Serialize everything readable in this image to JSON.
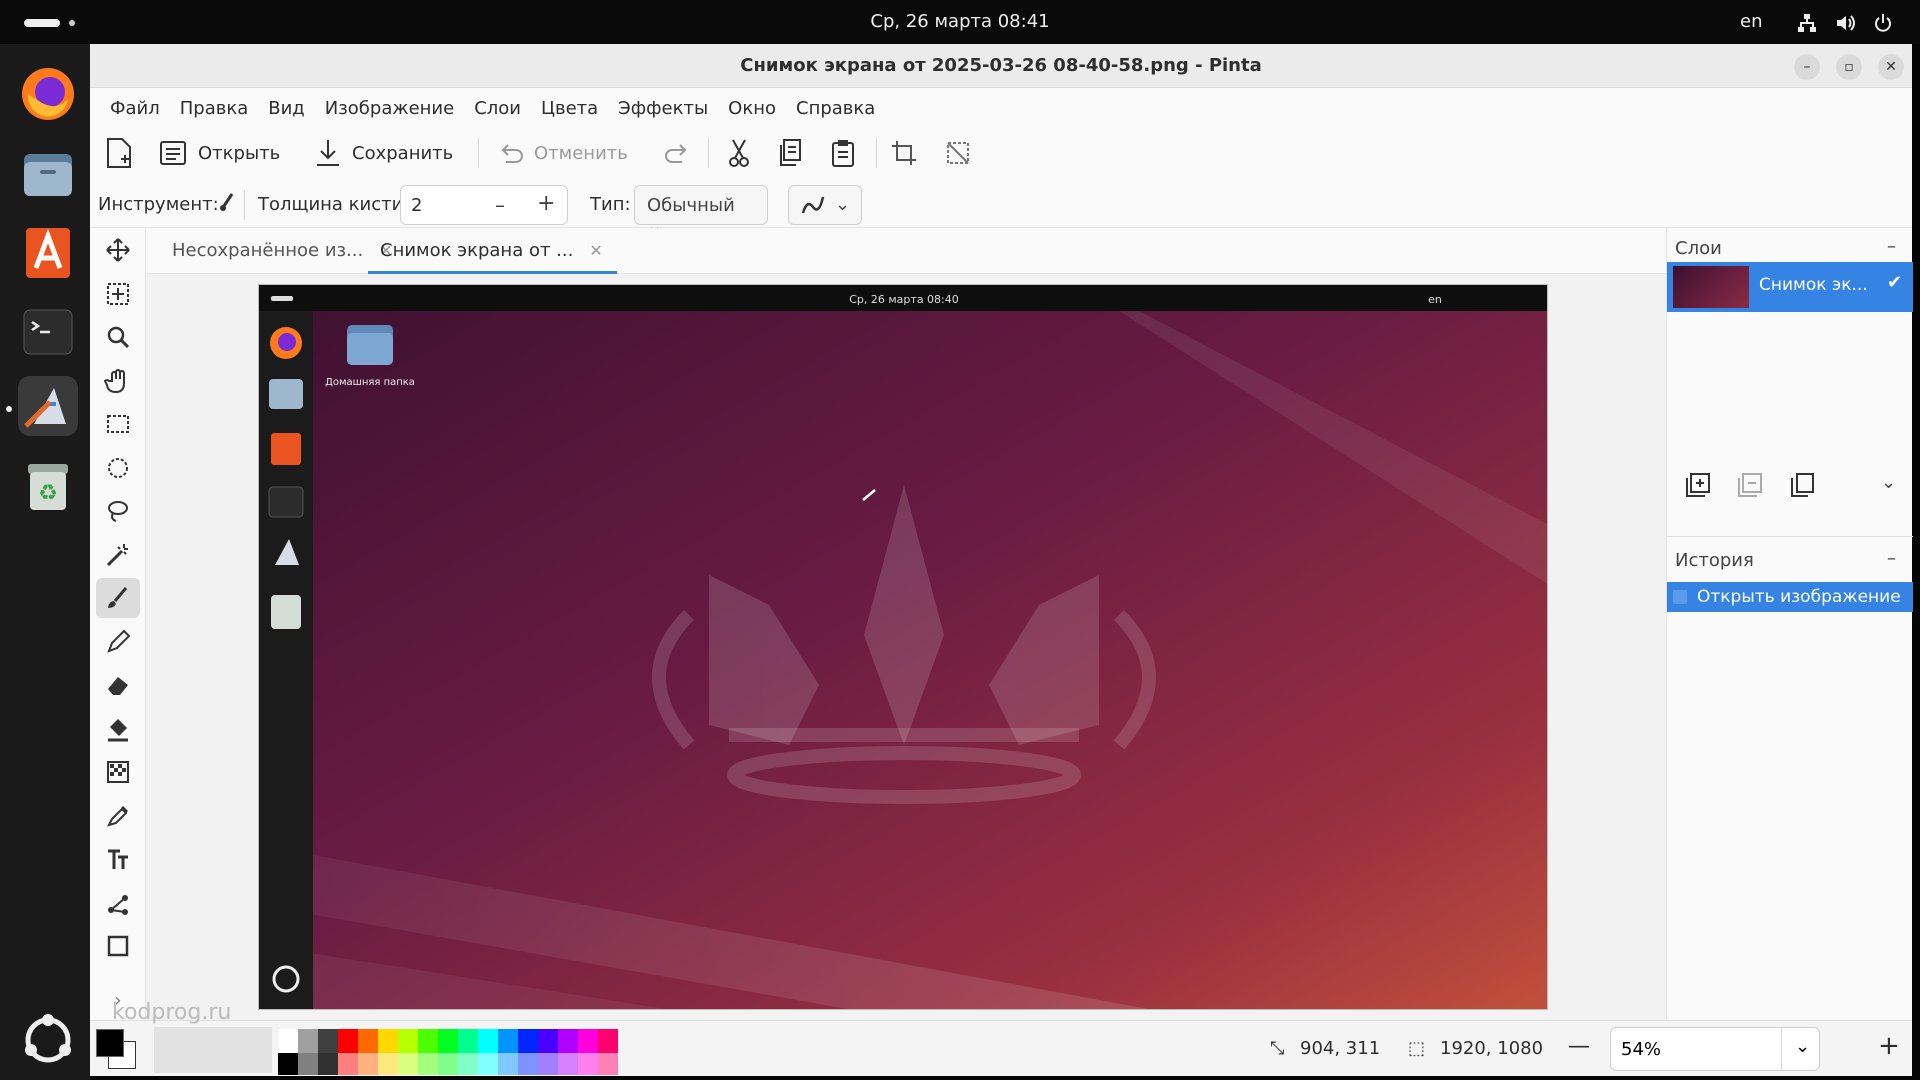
{
  "topbar": {
    "clock": "Ср, 26 марта  08:41",
    "lang": "en"
  },
  "window": {
    "title": "Снимок экрана от 2025-03-26 08-40-58.png - Pinta"
  },
  "menu": [
    "Файл",
    "Правка",
    "Вид",
    "Изображение",
    "Слои",
    "Цвета",
    "Эффекты",
    "Окно",
    "Справка"
  ],
  "toolbar": {
    "open_label": "Открыть",
    "save_label": "Сохранить",
    "undo_label": "Отменить"
  },
  "options": {
    "tool_label": "Инструмент:",
    "brush_width_label": "Толщина кисти:",
    "brush_width_value": "2",
    "type_label": "Тип:",
    "type_value": "Обычный"
  },
  "tabs": [
    {
      "label": "Несохранённое из...",
      "active": false
    },
    {
      "label": "Снимок экрана от ...",
      "active": true
    }
  ],
  "inner_screenshot": {
    "clock": "Ср, 26 марта  08:40",
    "lang": "en",
    "desktop_icon_label": "Домашняя папка"
  },
  "layers": {
    "header": "Слои",
    "items": [
      {
        "name": "Снимок эк...",
        "visible": true
      }
    ]
  },
  "history": {
    "header": "История",
    "items": [
      "Открыть изображение"
    ]
  },
  "status": {
    "cursor": "904, 311",
    "selection": "1920, 1080",
    "zoom": "54%"
  },
  "watermark": "kodprog.ru",
  "colors": {
    "accent": "#3584e4",
    "wallpaper_top": "#4a1533",
    "wallpaper_bottom": "#b8403a"
  }
}
